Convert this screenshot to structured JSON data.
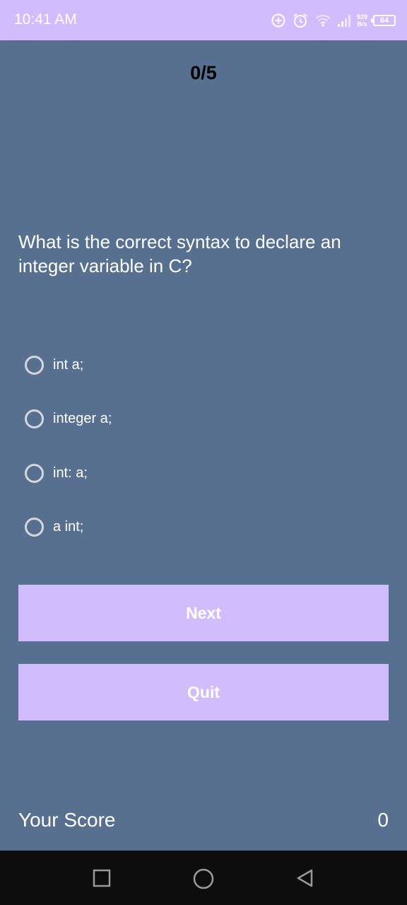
{
  "status_bar": {
    "time": "10:41 AM",
    "net_speed_value": "929",
    "net_speed_unit": "B/s",
    "battery": "64",
    "icons": [
      "data-saver-icon",
      "alarm-icon",
      "wifi-icon",
      "signal-icon",
      "battery-icon"
    ]
  },
  "quiz": {
    "progress": "0/5",
    "question": "What is the correct syntax to declare an integer variable in C?",
    "options": [
      {
        "label": "int a;"
      },
      {
        "label": "integer a;"
      },
      {
        "label": "int: a;"
      },
      {
        "label": "a int;"
      }
    ],
    "next_label": "Next",
    "quit_label": "Quit"
  },
  "score": {
    "label": "Your Score",
    "value": "0"
  },
  "nav_bar": {
    "icons": [
      "recents-icon",
      "home-icon",
      "back-icon"
    ]
  },
  "colors": {
    "background": "#57708f",
    "accent": "#d1bdfc",
    "nav_bar": "#0d0d0d"
  }
}
